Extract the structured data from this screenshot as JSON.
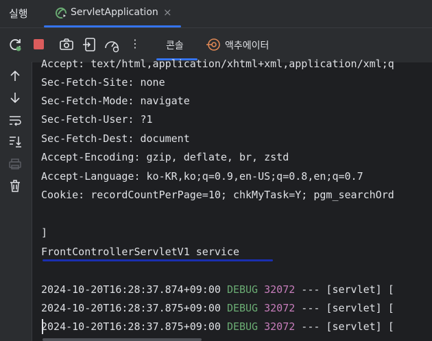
{
  "topbar": {
    "run_label": "실행",
    "tab_title": "ServletApplication",
    "close_glyph": "×"
  },
  "toolbar": {
    "console_tab": "콘솔",
    "actuator_tab": "액추에이터",
    "more_glyph": "⋮"
  },
  "console": {
    "lines": [
      "Accept: text/html,application/xhtml+xml,application/xml;q",
      "Sec-Fetch-Site: none",
      "Sec-Fetch-Mode: navigate",
      "Sec-Fetch-User: ?1",
      "Sec-Fetch-Dest: document",
      "Accept-Encoding: gzip, deflate, br, zstd",
      "Accept-Language: ko-KR,ko;q=0.9,en-US;q=0.8,en;q=0.7",
      "Cookie: recordCountPerPage=10; chkMyTask=Y; pgm_searchOrd",
      "",
      "]",
      "FrontControllerServletV1 service"
    ],
    "logs": [
      {
        "ts": "2024-10-20T16:28:37.874+09:00",
        "level": "DEBUG",
        "pid": "32072",
        "rest": " --- [servlet] ["
      },
      {
        "ts": "2024-10-20T16:28:37.875+09:00",
        "level": "DEBUG",
        "pid": "32072",
        "rest": " --- [servlet] ["
      },
      {
        "ts": "2024-10-20T16:28:37.875+09:00",
        "level": "DEBUG",
        "pid": "32072",
        "rest": " --- [servlet] ["
      }
    ]
  }
}
